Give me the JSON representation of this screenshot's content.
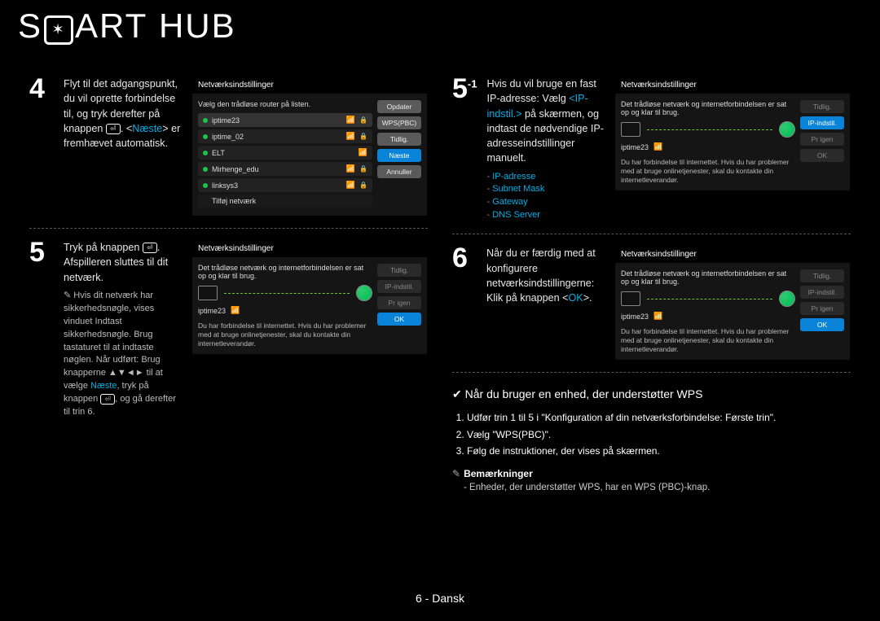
{
  "header": {
    "brand_pre": "S",
    "brand_logo": "✶",
    "brand_post": "ART",
    "brand_sub": "HUB"
  },
  "step4": {
    "num": "4",
    "text_pre": "Flyt til det adgangspunkt, du vil oprette forbindelse til, og tryk derefter på knappen ",
    "text_post": ". ",
    "hl_open": "<",
    "hl_word": "Næste",
    "hl_close": ">",
    "text_tail": " er fremhævet automatisk.",
    "tv": {
      "title": "Netværksindstillinger",
      "caption": "Vælg den trådløse router på listen.",
      "routers": [
        "iptime23",
        "iptime_02",
        "ELT",
        "Mirhenge_edu",
        "linksys3"
      ],
      "add": "Tilføj netværk",
      "side": [
        "Opdater",
        "WPS(PBC)",
        "Tidlig.",
        "Næste",
        "Annuller"
      ]
    }
  },
  "step5": {
    "num": "5",
    "text_pre": "Tryk på knappen ",
    "text_post": ". Afspilleren sluttes til dit netværk.",
    "note": "Hvis dit netværk har sikkerhedsnøgle, vises vinduet Indtast sikkerhedsnøgle. Brug tastaturet til at indtaste nøglen. Når udført: Brug knapperne ▲▼◄► til at vælge ",
    "note_hl": "Næste",
    "note_post": ", tryk på knappen ",
    "note_tail": ", og gå derefter til trin 6.",
    "tv": {
      "title": "Netværksindstillinger",
      "caption": "Det trådløse netværk og internetforbindelsen er sat op og klar til brug.",
      "name": "iptime23",
      "msg": "Du har forbindelse til internettet. Hvis du har problemer med at bruge onlinetjenester, skal du kontakte din internetleverandør.",
      "side": [
        "Tidlig.",
        "IP-indstil.",
        "Pr igen",
        "OK"
      ]
    }
  },
  "step51": {
    "num": "5",
    "sup": "-1",
    "text_pre": "Hvis du vil bruge en fast IP-adresse: Vælg ",
    "hl": "<IP-indstil.>",
    "text_post": " på skærmen, og indtast de nødvendige IP-adresseindstillinger manuelt.",
    "bullets": [
      "IP-adresse",
      "Subnet Mask",
      "Gateway",
      "DNS Server"
    ],
    "tv": {
      "title": "Netværksindstillinger",
      "caption": "Det trådløse netværk og internetforbindelsen er sat op og klar til brug.",
      "name": "iptime23",
      "msg": "Du har forbindelse til internettet. Hvis du har problemer med at bruge onlinetjenester, skal du kontakte din internetleverandør.",
      "side": [
        "Tidlig.",
        "IP-indstil.",
        "Pr igen",
        "OK"
      ],
      "hl_index": 1
    }
  },
  "step6": {
    "num": "6",
    "text_pre": "Når du er færdig med at konfigurere netværksindstillingerne: Klik på knappen <",
    "hl": "OK",
    "text_post": ">.",
    "tv": {
      "title": "Netværksindstillinger",
      "caption": "Det trådløse netværk og internetforbindelsen er sat op og klar til brug.",
      "name": "iptime23",
      "msg": "Du har forbindelse til internettet. Hvis du har problemer med at bruge onlinetjenester, skal du kontakte din internetleverandør.",
      "side": [
        "Tidlig.",
        "IP-indstil.",
        "Pr igen",
        "OK"
      ],
      "hl_index": 3
    }
  },
  "wps": {
    "heading": "✔  Når du bruger en enhed, der understøtter WPS",
    "items": [
      "Udfør trin 1 til 5 i \"Konfiguration af din netværksforbindelse: Første trin\".",
      "Vælg \"WPS(PBC)\".",
      "Følg de instruktioner, der vises på skærmen."
    ],
    "note_label": "Bemærkninger",
    "note_body": "Enheder, der understøtter WPS, har en WPS (PBC)-knap."
  },
  "footer": "6 - Dansk"
}
